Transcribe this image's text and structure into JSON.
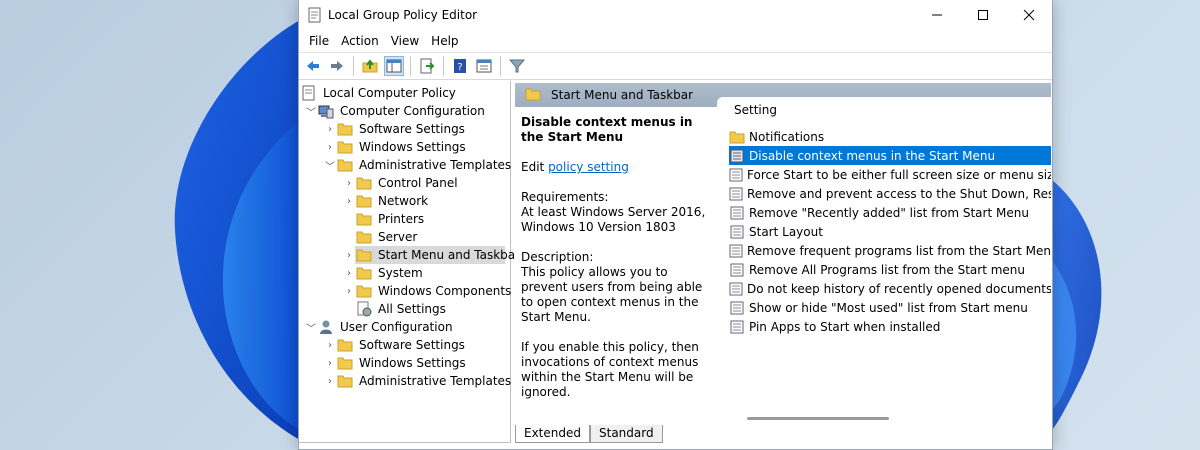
{
  "window": {
    "title": "Local Group Policy Editor"
  },
  "menu": [
    "File",
    "Action",
    "View",
    "Help"
  ],
  "toolbar": {
    "buttons": [
      "back-icon",
      "forward-icon",
      "up-folder-icon",
      "show-hide-tree-icon",
      "export-list-icon",
      "help-icon",
      "properties-icon",
      "filter-icon"
    ]
  },
  "tree": {
    "root": "Local Computer Policy",
    "computer_config": "Computer Configuration",
    "cc_software": "Software Settings",
    "cc_windows": "Windows Settings",
    "cc_admin": "Administrative Templates",
    "at_control_panel": "Control Panel",
    "at_network": "Network",
    "at_printers": "Printers",
    "at_server": "Server",
    "at_start_menu": "Start Menu and Taskbar",
    "at_system": "System",
    "at_windows_components": "Windows Components",
    "at_all_settings": "All Settings",
    "user_config": "User Configuration",
    "uc_software": "Software Settings",
    "uc_windows": "Windows Settings",
    "uc_admin": "Administrative Templates"
  },
  "header": {
    "title": "Start Menu and Taskbar"
  },
  "description": {
    "title": "Disable context menus in the Start Menu",
    "edit_prefix": "Edit ",
    "edit_link": "policy setting ",
    "requirements_label": "Requirements:",
    "requirements_text": "At least Windows Server 2016, Windows 10 Version 1803",
    "description_label": "Description:",
    "description_text": "This policy allows you to prevent users from being able to open context menus in the Start Menu.",
    "description_text2": "If you enable this policy, then invocations of context menus within the Start Menu will be ignored."
  },
  "settings": {
    "column_header": "Setting",
    "items": [
      "Notifications",
      "Disable context menus in the Start Menu",
      "Force Start to be either full screen size or menu size",
      "Remove and prevent access to the Shut Down, Restart, Sl",
      "Remove \"Recently added\" list from Start Menu",
      "Start Layout",
      "Remove frequent programs list from the Start Menu",
      "Remove All Programs list from the Start menu",
      "Do not keep history of recently opened documents",
      "Show or hide \"Most used\" list from Start menu",
      "Pin Apps to Start when installed"
    ]
  },
  "tabs": {
    "extended": "Extended",
    "standard": "Standard"
  },
  "colors": {
    "selection": "#0078d7",
    "link": "#0066cc",
    "header_strip": "#aebdcc"
  }
}
